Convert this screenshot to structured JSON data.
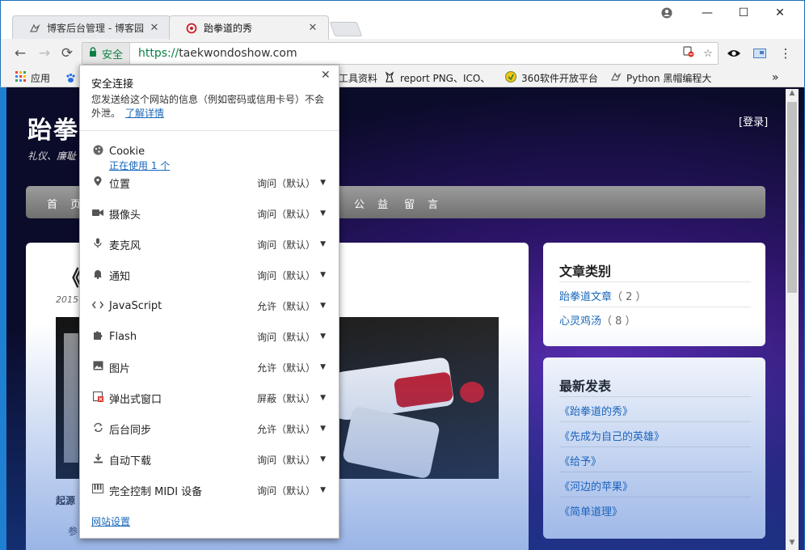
{
  "tabs": [
    {
      "title": "博客后台管理 - 博客园",
      "close": "✕",
      "favicon": "bird-icon"
    },
    {
      "title": "跆拳道的秀",
      "close": "✕",
      "favicon": "site-icon"
    }
  ],
  "window": {
    "minimize": "—",
    "maximize": "☐",
    "close": "✕"
  },
  "toolbar": {
    "back": "←",
    "forward": "→",
    "reload": "⟳",
    "secure_label": "安全",
    "url_scheme": "https://",
    "url_host": "taekwondoshow.com",
    "blocked_icon": "⛔",
    "star": "☆",
    "eye": "👁",
    "cast": "▭",
    "menu": "⋮"
  },
  "bookmarks": [
    {
      "label": "应用",
      "icon": "apps-icon"
    },
    {
      "label": "工具资料",
      "icon": "folder-icon"
    },
    {
      "label": "report PNG、ICO、",
      "icon": "bookmark-icon"
    },
    {
      "label": "360软件开放平台",
      "icon": "bookmark-icon"
    },
    {
      "label": "Python 黑帽编程大",
      "icon": "bookmark-icon"
    },
    {
      "label": "»",
      "icon": "more-icon"
    }
  ],
  "site": {
    "title": "跆拳道",
    "subtitle": "礼仪、廉耻",
    "login": "[登录]",
    "nav": [
      "首 页",
      "公 益",
      "留 言"
    ],
    "post_title": "《跆",
    "post_date": "2015-",
    "post_origin": "起源",
    "post_text": "参"
  },
  "sidebar": {
    "categories_title": "文章类别",
    "categories": [
      {
        "name": "跆拳道文章",
        "count": "（ 2 ）"
      },
      {
        "name": "心灵鸡汤",
        "count": "（ 8 ）"
      }
    ],
    "latest_title": "最新发表",
    "latest": [
      "《跆拳道的秀》",
      "《先成为自己的英雄》",
      "《给予》",
      "《河边的苹果》",
      "《简单道理》"
    ]
  },
  "popup": {
    "title": "安全连接",
    "close": "✕",
    "desc": "您发送给这个网站的信息（例如密码或信用卡号）不会外泄。",
    "learn_more": "了解详情",
    "cookie_label": "Cookie",
    "cookie_sub": "正在使用 1 个",
    "permissions": [
      {
        "label": "位置",
        "value": "询问（默认）",
        "icon": "location-icon"
      },
      {
        "label": "摄像头",
        "value": "询问（默认）",
        "icon": "camera-icon"
      },
      {
        "label": "麦克风",
        "value": "询问（默认）",
        "icon": "microphone-icon"
      },
      {
        "label": "通知",
        "value": "询问（默认）",
        "icon": "bell-icon"
      },
      {
        "label": "JavaScript",
        "value": "允许（默认）",
        "icon": "code-icon"
      },
      {
        "label": "Flash",
        "value": "询问（默认）",
        "icon": "puzzle-icon"
      },
      {
        "label": "图片",
        "value": "允许（默认）",
        "icon": "image-icon"
      },
      {
        "label": "弹出式窗口",
        "value": "屏蔽（默认）",
        "icon": "popup-icon"
      },
      {
        "label": "后台同步",
        "value": "允许（默认）",
        "icon": "sync-icon"
      },
      {
        "label": "自动下载",
        "value": "询问（默认）",
        "icon": "download-icon"
      },
      {
        "label": "完全控制 MIDI 设备",
        "value": "询问（默认）",
        "icon": "piano-icon"
      }
    ],
    "site_settings": "网站设置"
  }
}
